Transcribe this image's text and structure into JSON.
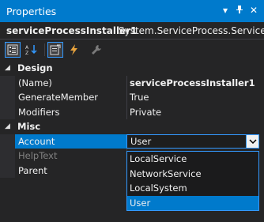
{
  "panel": {
    "title": "Properties",
    "pin_glyph": "▾",
    "autohide_glyph": "⊣",
    "close_glyph": "✕"
  },
  "object_selector": {
    "name": "serviceProcessInstaller1",
    "type": "System.ServiceProcess.ServiceP",
    "arrow": "▼"
  },
  "toolbar": {
    "categorized_icon": "categorized-icon",
    "alphabetical_icon": "alphabetical-icon",
    "properties_icon": "properties-icon",
    "events_icon": "events-icon",
    "property_pages_icon": "wrench-icon"
  },
  "categories": [
    {
      "label": "Design",
      "properties": [
        {
          "name": "(Name)",
          "value": "serviceProcessInstaller1",
          "bold": true
        },
        {
          "name": "GenerateMember",
          "value": "True"
        },
        {
          "name": "Modifiers",
          "value": "Private"
        }
      ]
    },
    {
      "label": "Misc",
      "properties": [
        {
          "name": "Account",
          "value": "User",
          "selected": true
        },
        {
          "name": "HelpText",
          "value": "",
          "dim": true
        },
        {
          "name": "Parent",
          "value": ""
        }
      ]
    }
  ],
  "dropdown": {
    "options": [
      "LocalService",
      "NetworkService",
      "LocalSystem",
      "User"
    ],
    "selected": "User",
    "button_glyph": "⌄"
  },
  "colors": {
    "accent": "#007acc",
    "background": "#252526",
    "text": "#f1f1f1"
  }
}
